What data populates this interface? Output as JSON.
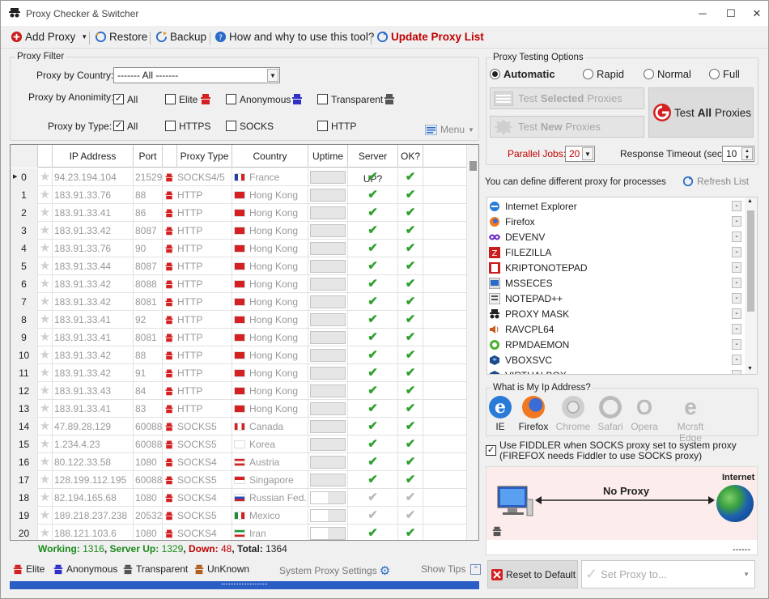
{
  "window": {
    "title": "Proxy Checker & Switcher",
    "minimize": "─",
    "maximize": "☐",
    "close": "✕"
  },
  "toolbar": {
    "add_proxy": "Add Proxy",
    "restore": "Restore",
    "backup": "Backup",
    "howto": "How and why to use this tool?",
    "update": "Update Proxy List"
  },
  "filter": {
    "group_title": "Proxy Filter",
    "country_label": "Proxy by Country:",
    "country_value": "------- All -------",
    "anonimity_label": "Proxy by Anonimity:",
    "anon_all": "All",
    "anon_elite": "Elite",
    "anon_anonymous": "Anonymous",
    "anon_transparent": "Transparent",
    "type_label": "Proxy by Type:",
    "type_all": "All",
    "type_https": "HTTPS",
    "type_socks": "SOCKS",
    "type_http": "HTTP",
    "menu": "Menu"
  },
  "grid": {
    "headers": [
      "IP Address",
      "Port",
      "Proxy Type",
      "Country",
      "Uptime",
      "Server UP?",
      "OK?"
    ],
    "rows": [
      {
        "n": "0",
        "ip": "94.23.194.104",
        "port": "21529",
        "type": "SOCKS4/5",
        "country": "France",
        "flag": "fr",
        "up": 0,
        "ok": "green"
      },
      {
        "n": "1",
        "ip": "183.91.33.76",
        "port": "88",
        "type": "HTTP",
        "country": "Hong Kong",
        "flag": "hk",
        "up": 0,
        "ok": "green"
      },
      {
        "n": "2",
        "ip": "183.91.33.41",
        "port": "86",
        "type": "HTTP",
        "country": "Hong Kong",
        "flag": "hk",
        "up": 0,
        "ok": "green"
      },
      {
        "n": "3",
        "ip": "183.91.33.42",
        "port": "8087",
        "type": "HTTP",
        "country": "Hong Kong",
        "flag": "hk",
        "up": 0,
        "ok": "green"
      },
      {
        "n": "4",
        "ip": "183.91.33.76",
        "port": "90",
        "type": "HTTP",
        "country": "Hong Kong",
        "flag": "hk",
        "up": 0,
        "ok": "green"
      },
      {
        "n": "5",
        "ip": "183.91.33.44",
        "port": "8087",
        "type": "HTTP",
        "country": "Hong Kong",
        "flag": "hk",
        "up": 0,
        "ok": "green"
      },
      {
        "n": "6",
        "ip": "183.91.33.42",
        "port": "8088",
        "type": "HTTP",
        "country": "Hong Kong",
        "flag": "hk",
        "up": 0,
        "ok": "green"
      },
      {
        "n": "7",
        "ip": "183.91.33.42",
        "port": "8081",
        "type": "HTTP",
        "country": "Hong Kong",
        "flag": "hk",
        "up": 0,
        "ok": "green"
      },
      {
        "n": "8",
        "ip": "183.91.33.41",
        "port": "92",
        "type": "HTTP",
        "country": "Hong Kong",
        "flag": "hk",
        "up": 0,
        "ok": "green"
      },
      {
        "n": "9",
        "ip": "183.91.33.41",
        "port": "8081",
        "type": "HTTP",
        "country": "Hong Kong",
        "flag": "hk",
        "up": 0,
        "ok": "green"
      },
      {
        "n": "10",
        "ip": "183.91.33.42",
        "port": "88",
        "type": "HTTP",
        "country": "Hong Kong",
        "flag": "hk",
        "up": 0,
        "ok": "green"
      },
      {
        "n": "11",
        "ip": "183.91.33.42",
        "port": "91",
        "type": "HTTP",
        "country": "Hong Kong",
        "flag": "hk",
        "up": 0,
        "ok": "green"
      },
      {
        "n": "12",
        "ip": "183.91.33.43",
        "port": "84",
        "type": "HTTP",
        "country": "Hong Kong",
        "flag": "hk",
        "up": 0,
        "ok": "green"
      },
      {
        "n": "13",
        "ip": "183.91.33.41",
        "port": "83",
        "type": "HTTP",
        "country": "Hong Kong",
        "flag": "hk",
        "up": 0,
        "ok": "green"
      },
      {
        "n": "14",
        "ip": "47.89.28.129",
        "port": "60088",
        "type": "SOCKS5",
        "country": "Canada",
        "flag": "ca",
        "up": 0,
        "ok": "green"
      },
      {
        "n": "15",
        "ip": "1.234.4.23",
        "port": "60088",
        "type": "SOCKS5",
        "country": "Korea",
        "flag": "kr",
        "up": 0,
        "ok": "green"
      },
      {
        "n": "16",
        "ip": "80.122.33.58",
        "port": "1080",
        "type": "SOCKS4",
        "country": "Austria",
        "flag": "at",
        "up": 0,
        "ok": "green"
      },
      {
        "n": "17",
        "ip": "128.199.112.195",
        "port": "60088",
        "type": "SOCKS5",
        "country": "Singapore",
        "flag": "sg",
        "up": 0,
        "ok": "green"
      },
      {
        "n": "18",
        "ip": "82.194.165.68",
        "port": "1080",
        "type": "SOCKS4",
        "country": "Russian Fed...",
        "flag": "ru",
        "up": 0.5,
        "ok": "grey"
      },
      {
        "n": "19",
        "ip": "189.218.237.238",
        "port": "20532",
        "type": "SOCKS5",
        "country": "Mexico",
        "flag": "mx",
        "up": 0.5,
        "ok": "grey"
      },
      {
        "n": "20",
        "ip": "188.121.103.6",
        "port": "1080",
        "type": "SOCKS4",
        "country": "Iran",
        "flag": "ir",
        "up": 0.5,
        "ok": "green"
      }
    ]
  },
  "stats": {
    "working_label": "Working:",
    "working": "1316",
    "serverup_label": "Server Up:",
    "serverup": "1329",
    "down_label": "Down:",
    "down": "48",
    "total_label": "Total:",
    "total": "1364",
    "sep": ","
  },
  "legend": {
    "elite": "Elite",
    "anonymous": "Anonymous",
    "transparent": "Transparent",
    "unknown": "UnKnown",
    "system_proxy": "System Proxy Settings",
    "show_tips": "Show Tips"
  },
  "testing": {
    "group_title": "Proxy Testing Options",
    "automatic": "Automatic",
    "rapid": "Rapid",
    "normal": "Normal",
    "full": "Full",
    "test_selected_pre": "Test",
    "test_selected_b": "Selected",
    "test_selected_post": "Proxies",
    "test_new_pre": "Test",
    "test_new_b": "New",
    "test_new_post": "Proxies",
    "test_all_pre": "Test",
    "test_all_b": "All",
    "test_all_post": "Proxies",
    "parallel_label": "Parallel Jobs:",
    "parallel_value": "20",
    "timeout_label": "Response Timeout (sec):",
    "timeout_value": "10"
  },
  "processes": {
    "hint": "You can define different proxy for processes",
    "refresh": "Refresh List",
    "items": [
      "Internet Explorer",
      "Firefox",
      "DEVENV",
      "FILEZILLA",
      "KRIPTONOTEPAD",
      "MSSECES",
      "NOTEPAD++",
      "PROXY MASK",
      "RAVCPL64",
      "RPMDAEMON",
      "VBOXSVC",
      "VIRTUALBOX"
    ],
    "dash": "-"
  },
  "myip": {
    "title": "What is My Ip Address?",
    "browsers": [
      "IE",
      "Firefox",
      "Chrome",
      "Safari",
      "Opera",
      "Mcrsft Edge"
    ]
  },
  "fiddler": {
    "line1": "Use FIDDLER when SOCKS proxy set to system proxy",
    "line2": "(FIREFOX needs Fiddler to use SOCKS proxy)"
  },
  "diagram": {
    "label": "No Proxy",
    "internet": "Internet",
    "dashes": "------"
  },
  "actions": {
    "reset": "Reset to Default",
    "set_proxy": "Set Proxy to..."
  },
  "colors": {
    "green_text": "#1a8a1a",
    "red_text": "#c00000",
    "accent_blue": "#2a5ec4",
    "check_green": "#2ea02e"
  }
}
